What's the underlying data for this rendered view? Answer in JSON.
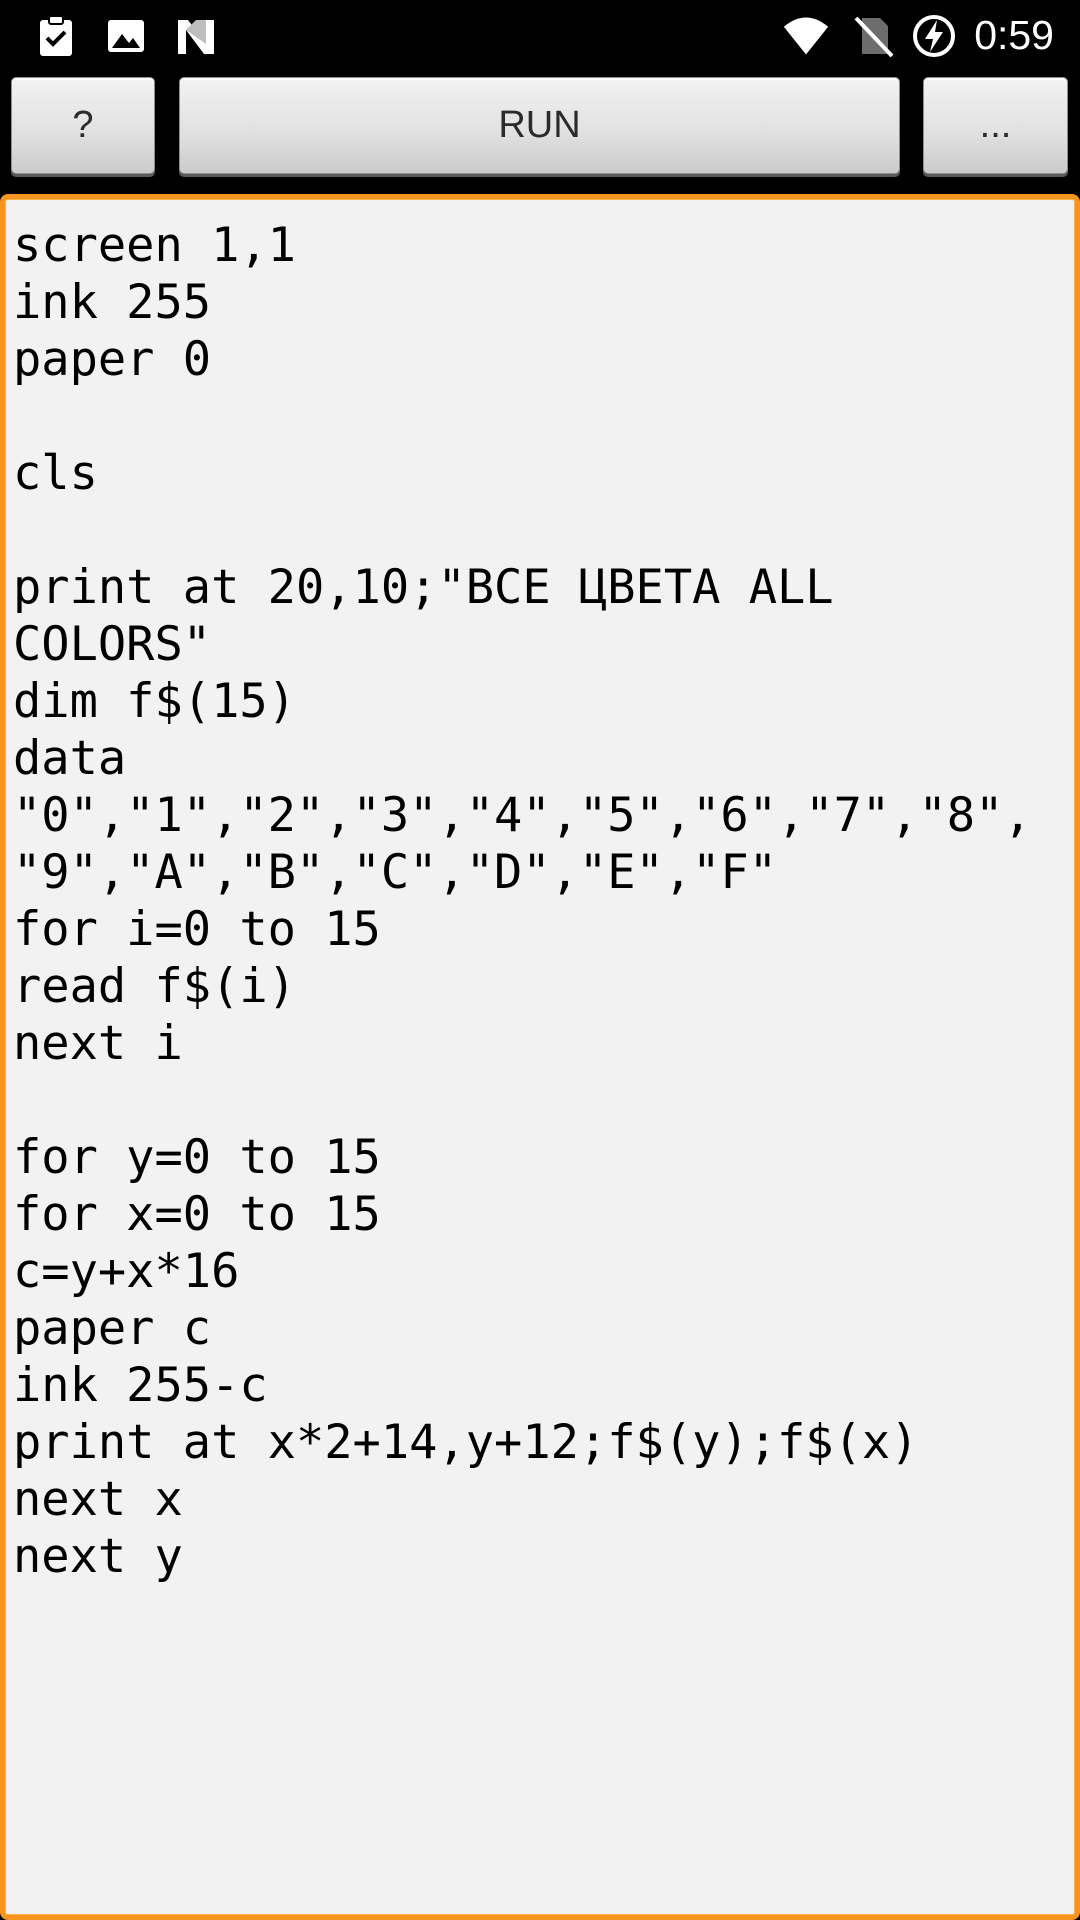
{
  "status_bar": {
    "left_icons": [
      "clipboard-check-icon",
      "image-icon",
      "n-logo-icon"
    ],
    "right_icons": [
      "wifi-icon",
      "no-sim-icon",
      "battery-charging-icon"
    ],
    "clock": "0:59"
  },
  "toolbar": {
    "help_label": "?",
    "run_label": "RUN",
    "more_label": "..."
  },
  "editor": {
    "lines": [
      "screen 1,1",
      "ink 255",
      "paper 0",
      "",
      "cls",
      "",
      "print at 20,10;\"ВСЕ ЦВЕТА ALL",
      "COLORS\"",
      "dim f$(15)",
      "data",
      "\"0\",\"1\",\"2\",\"3\",\"4\",\"5\",\"6\",\"7\",\"8\",",
      "\"9\",\"A\",\"B\",\"C\",\"D\",\"E\",\"F\"",
      "for i=0 to 15",
      "read f$(i)",
      "next i",
      "",
      "for y=0 to 15",
      "for x=0 to 15",
      "c=y+x*16",
      "paper c",
      "ink 255-c",
      "print at x*2+14,y+12;f$(y);f$(x)",
      "next x",
      "next y"
    ]
  },
  "colors": {
    "editor_border": "#f7941e",
    "editor_background": "#f2f2f2",
    "status_bar_background": "#000000",
    "button_face": "#e2e2e2"
  }
}
